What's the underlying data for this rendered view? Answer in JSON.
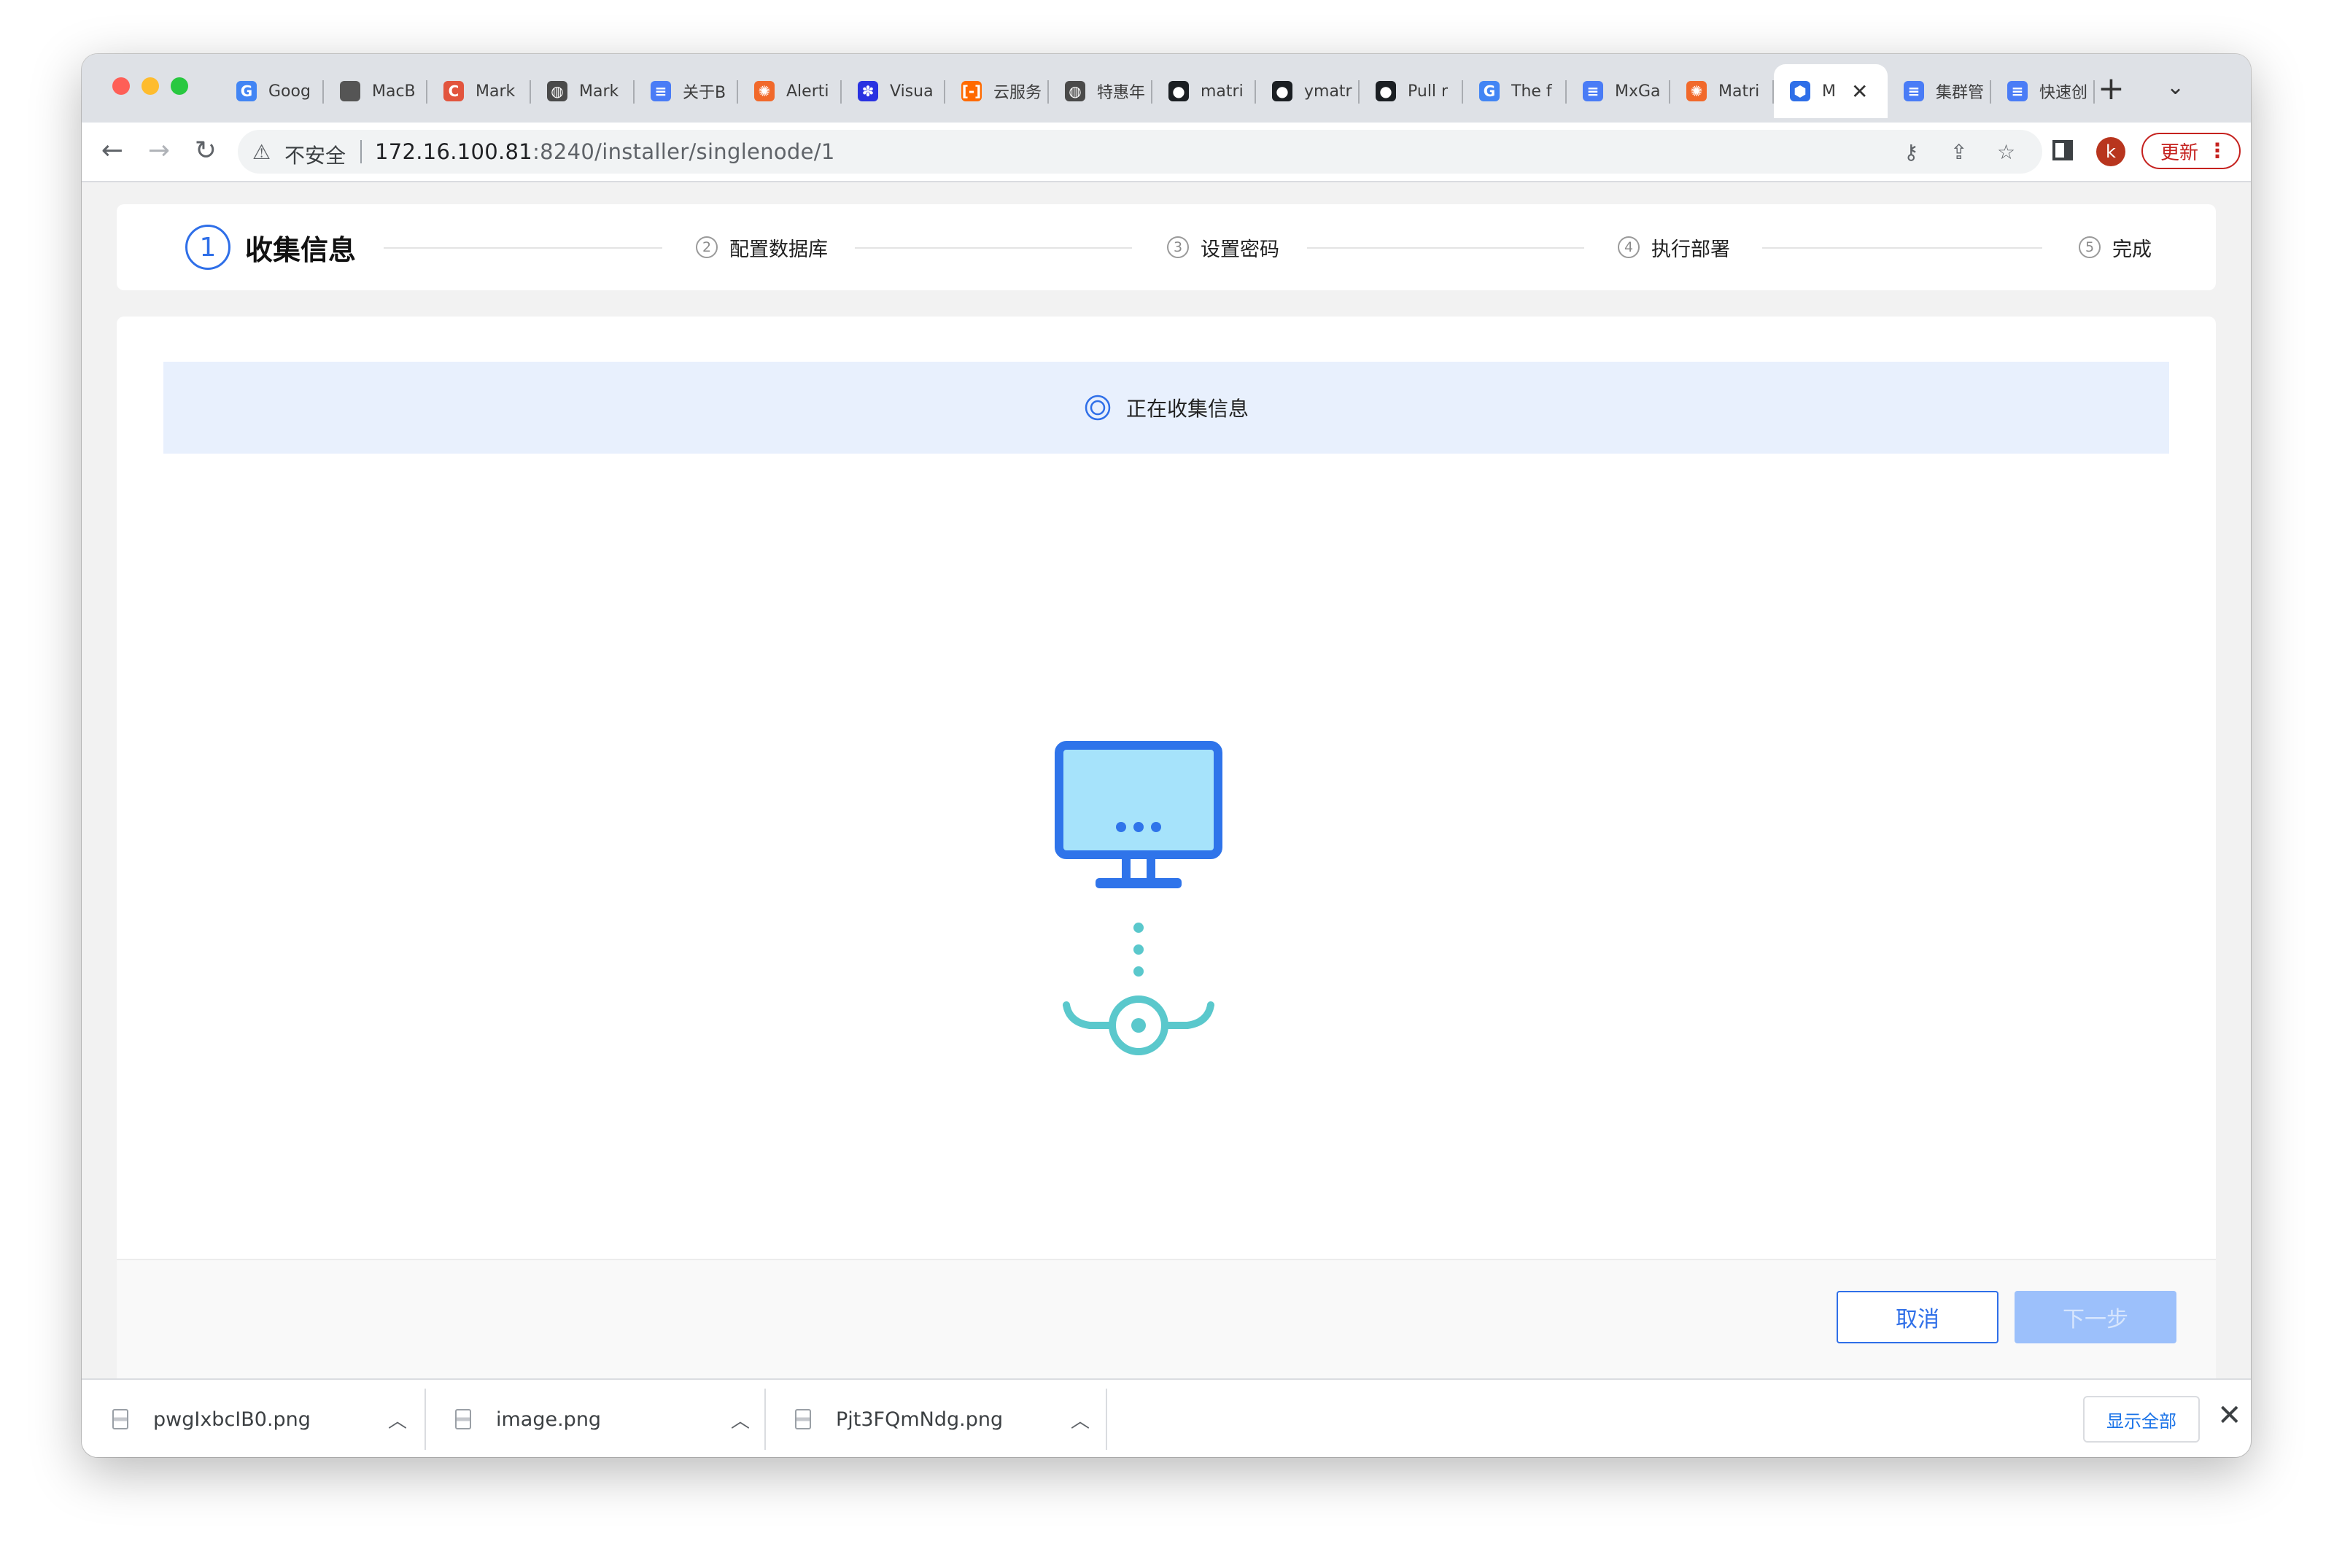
{
  "browser": {
    "tabs": [
      {
        "title": "Goog",
        "favicon": "google-docs-icon",
        "color": "#4285f4",
        "glyph": "G"
      },
      {
        "title": "MacB",
        "favicon": "apple-icon",
        "color": "#555555",
        "glyph": ""
      },
      {
        "title": "Mark",
        "favicon": "markdown-c-icon",
        "color": "#e2553e",
        "glyph": "C"
      },
      {
        "title": "Mark",
        "favicon": "globe-icon",
        "color": "#4a4a4a",
        "glyph": "◍"
      },
      {
        "title": "关于B",
        "favicon": "doc-icon",
        "color": "#4a7cf6",
        "glyph": "≡"
      },
      {
        "title": "Alerti",
        "favicon": "grafana-icon",
        "color": "#f1692b",
        "glyph": "✺"
      },
      {
        "title": "Visua",
        "favicon": "baidu-icon",
        "color": "#2932e1",
        "glyph": "✽"
      },
      {
        "title": "云服务",
        "favicon": "aliyun-icon",
        "color": "#ff6a00",
        "glyph": "[-]"
      },
      {
        "title": "特惠年",
        "favicon": "globe-icon",
        "color": "#4a4a4a",
        "glyph": "◍"
      },
      {
        "title": "matri",
        "favicon": "github-icon",
        "color": "#1b1f23",
        "glyph": "●"
      },
      {
        "title": "ymatr",
        "favicon": "github-icon",
        "color": "#1b1f23",
        "glyph": "●"
      },
      {
        "title": "Pull r",
        "favicon": "github-icon",
        "color": "#1b1f23",
        "glyph": "●"
      },
      {
        "title": "The f",
        "favicon": "google-icon",
        "color": "#4285f4",
        "glyph": "G"
      },
      {
        "title": "MxGa",
        "favicon": "doc-icon",
        "color": "#4a7cf6",
        "glyph": "≡"
      },
      {
        "title": "Matri",
        "favicon": "grafana-icon",
        "color": "#f1692b",
        "glyph": "✺"
      },
      {
        "title": "M",
        "favicon": "matrixdb-icon",
        "color": "#2f6fe8",
        "glyph": "⬢",
        "active": true
      },
      {
        "title": "集群管",
        "favicon": "doc-icon",
        "color": "#4a7cf6",
        "glyph": "≡"
      },
      {
        "title": "快速创",
        "favicon": "doc-icon",
        "color": "#4a7cf6",
        "glyph": "≡"
      }
    ],
    "security_label": "不安全",
    "url_host": "172.16.100.81",
    "url_rest": ":8240/installer/singlenode/1",
    "profile_initial": "k",
    "update_label": "更新"
  },
  "wizard": {
    "steps": [
      {
        "num": "1",
        "label": "收集信息",
        "current": true
      },
      {
        "num": "2",
        "label": "配置数据库"
      },
      {
        "num": "3",
        "label": "设置密码"
      },
      {
        "num": "4",
        "label": "执行部署"
      },
      {
        "num": "5",
        "label": "完成"
      }
    ],
    "status_text": "正在收集信息",
    "cancel_label": "取消",
    "next_label": "下一步"
  },
  "downloads": {
    "items": [
      {
        "filename": "pwgIxbcIB0.png"
      },
      {
        "filename": "image.png"
      },
      {
        "filename": "Pjt3FQmNdg.png"
      }
    ],
    "show_all_label": "显示全部"
  },
  "colors": {
    "accent": "#2f6fe8",
    "banner_bg": "#e8f0fd",
    "monitor_fill": "#a6e3fb",
    "connector": "#5ac8cc"
  }
}
